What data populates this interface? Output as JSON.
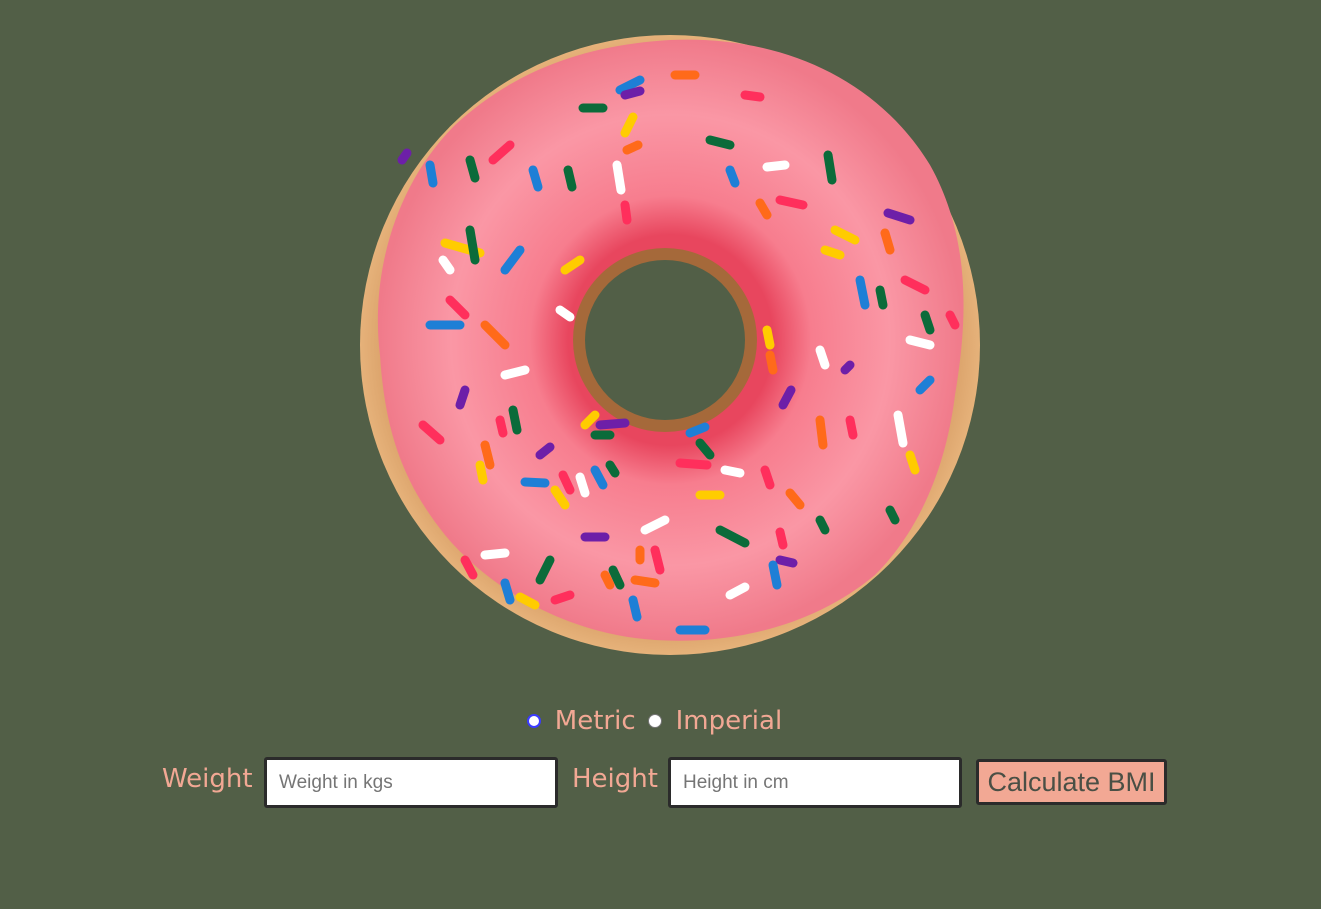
{
  "colors": {
    "background": "#525f47",
    "accent_text": "#f2a894",
    "button_bg": "#f2a894",
    "icing": "#f78e9c",
    "dough": "#c98a52"
  },
  "illustration": {
    "icon": "donut-illustration"
  },
  "units": {
    "selected": "Metric",
    "options": [
      {
        "label": "Metric"
      },
      {
        "label": "Imperial"
      }
    ]
  },
  "form": {
    "weight": {
      "label": "Weight",
      "placeholder": "Weight in kgs",
      "value": ""
    },
    "height": {
      "label": "Height",
      "placeholder": "Height in cm",
      "value": ""
    },
    "submit_label": "Calculate BMI"
  }
}
